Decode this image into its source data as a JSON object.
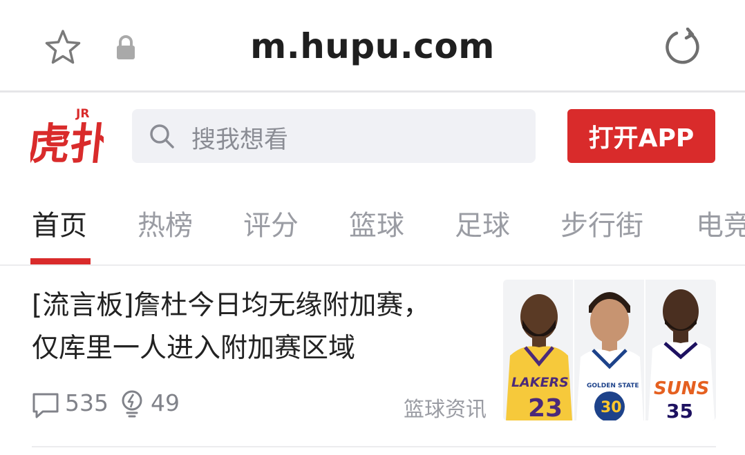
{
  "browser": {
    "url": "m.hupu.com"
  },
  "header": {
    "logo_text": "虎扑",
    "logo_badge": "JR",
    "search_placeholder": "搜我想看",
    "open_app_label": "打开APP"
  },
  "tabs": [
    {
      "label": "首页",
      "active": true
    },
    {
      "label": "热榜",
      "active": false
    },
    {
      "label": "评分",
      "active": false
    },
    {
      "label": "篮球",
      "active": false
    },
    {
      "label": "足球",
      "active": false
    },
    {
      "label": "步行街",
      "active": false
    },
    {
      "label": "电竞",
      "active": false
    }
  ],
  "news": {
    "title_line1": "[流言板]詹杜今日均无缘附加赛，",
    "title_line2": "仅库里一人进入附加赛区域",
    "comments": "535",
    "lights": "49",
    "category": "篮球资讯",
    "thumbnail": {
      "players": [
        {
          "team_text": "LAKERS",
          "number": "23",
          "jersey_color": "#f6c93b"
        },
        {
          "team_text": "GOLDEN STATE",
          "number": "30",
          "jersey_color": "#ffffff"
        },
        {
          "team_text": "SUNS",
          "number": "35",
          "jersey_color": "#ffffff"
        }
      ]
    }
  },
  "colors": {
    "accent": "#d92b2b",
    "text_primary": "#222222",
    "text_secondary": "#9a9ca3"
  }
}
